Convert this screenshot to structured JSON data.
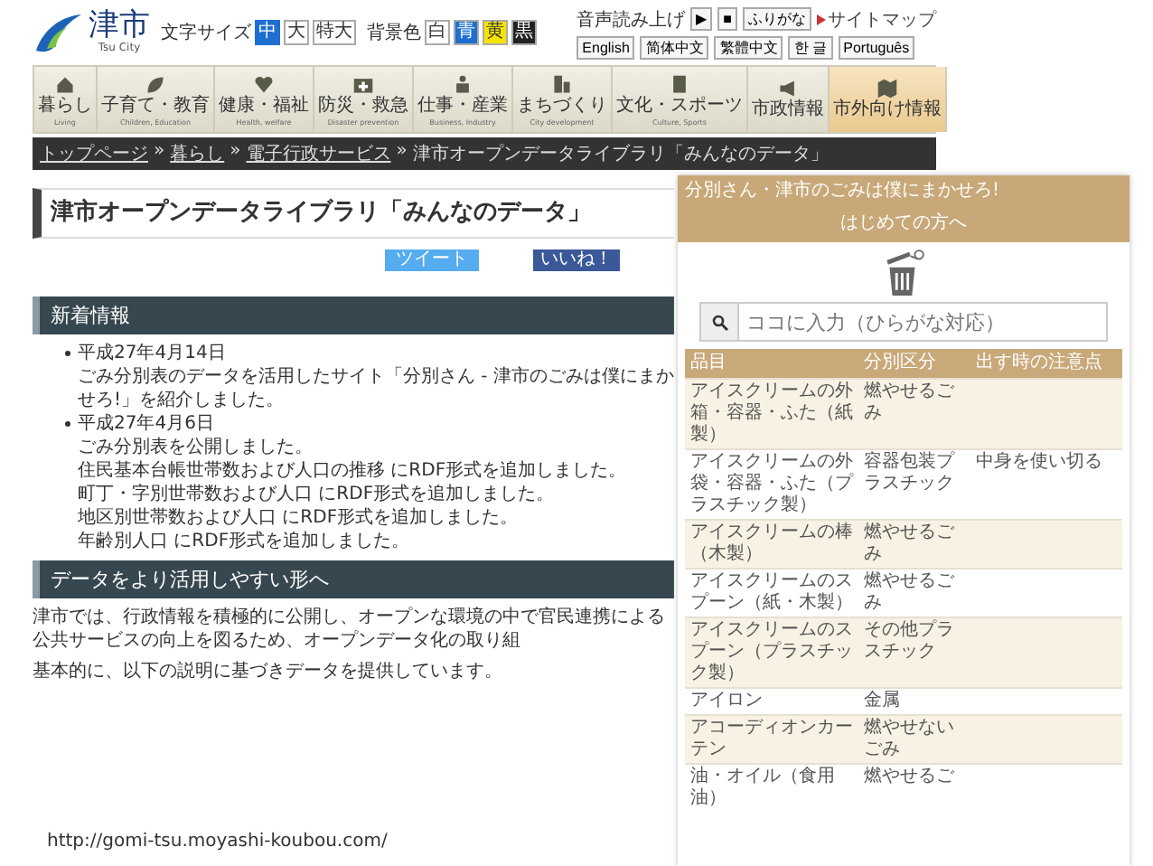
{
  "header": {
    "logo_kanji": "津市",
    "logo_roman": "Tsu City",
    "text_size": {
      "label": "文字サイズ",
      "options": [
        {
          "label": "中",
          "selected": true
        },
        {
          "label": "大",
          "selected": false
        },
        {
          "label": "特大",
          "selected": false
        }
      ]
    },
    "background": {
      "label": "背景色",
      "options": [
        {
          "label": "白",
          "color": "#ffffff"
        },
        {
          "label": "青",
          "color": "#1e6fd0"
        },
        {
          "label": "黄",
          "color": "#f5e400"
        },
        {
          "label": "黒",
          "color": "#222222"
        }
      ]
    },
    "speech": {
      "label": "音声読み上げ",
      "play": "▶",
      "stop": "■"
    },
    "furigana": "ふりがな",
    "sitemap": "サイトマップ",
    "languages": [
      "English",
      "简体中文",
      "繁體中文",
      "한 글",
      "Português"
    ]
  },
  "nav": [
    {
      "label": "暮らし",
      "sub": "Living",
      "selected": false
    },
    {
      "label": "子育て・教育",
      "sub": "Children, Education",
      "selected": false
    },
    {
      "label": "健康・福祉",
      "sub": "Health, welfare",
      "selected": false
    },
    {
      "label": "防災・救急",
      "sub": "Disaster prevention",
      "selected": false
    },
    {
      "label": "仕事・産業",
      "sub": "Business, Industry",
      "selected": false
    },
    {
      "label": "まちづくり",
      "sub": "City development",
      "selected": false
    },
    {
      "label": "文化・スポーツ",
      "sub": "Culture, Sports",
      "selected": false
    },
    {
      "label": "市政情報",
      "selected": false
    },
    {
      "label": "市外向け情報",
      "selected": true
    }
  ],
  "breadcrumb": {
    "separator": "»",
    "items": [
      "トップページ",
      "暮らし",
      "電子行政サービス"
    ],
    "current": "津市オープンデータライブラリ「みんなのデータ」"
  },
  "page_title": "津市オープンデータライブラリ「みんなのデータ」",
  "share": {
    "tweet": "ツイート",
    "like": "いいね！"
  },
  "news": {
    "heading": "新着情報",
    "items": [
      {
        "date": "平成27年4月14日",
        "lines": [
          "ごみ分別表のデータを活用したサイト「分別さん - 津市のごみは僕にまかせろ!」を紹介しました。"
        ]
      },
      {
        "date": "平成27年4月6日",
        "lines": [
          "ごみ分別表を公開しました。",
          "住民基本台帳世帯数および人口の推移 にRDF形式を追加しました。",
          "町丁・字別世帯数および人口 にRDF形式を追加しました。",
          "地区別世帯数および人口 にRDF形式を追加しました。",
          "年齢別人口 にRDF形式を追加しました。"
        ]
      }
    ]
  },
  "data_section": {
    "heading": "データをより活用しやすい形へ",
    "paragraphs": [
      "津市では、行政情報を積極的に公開し、オープンな環境の中で官民連携による公共サービスの向上を図るため、オープンデータ化の取り組",
      "基本的に、以下の説明に基づきデータを提供しています。"
    ]
  },
  "source_url": "http://gomi-tsu.moyashi-koubou.com/",
  "app": {
    "tagline": "分別さん・津市のごみは僕にまかせろ!",
    "intro_link": "はじめての方へ",
    "search": {
      "placeholder": "ココに入力（ひらがな対応）"
    },
    "table": {
      "columns": [
        "品目",
        "分別区分",
        "出す時の注意点"
      ],
      "rows": [
        [
          "アイスクリームの外箱・容器・ふた（紙製）",
          "燃やせるごみ",
          ""
        ],
        [
          "アイスクリームの外袋・容器・ふた（プラスチック製）",
          "容器包装プラスチック",
          "中身を使い切る"
        ],
        [
          "アイスクリームの棒（木製）",
          "燃やせるごみ",
          ""
        ],
        [
          "アイスクリームのスプーン（紙・木製）",
          "燃やせるごみ",
          ""
        ],
        [
          "アイスクリームのスプーン（プラスチック製）",
          "その他プラスチック",
          ""
        ],
        [
          "アイロン",
          "金属",
          ""
        ],
        [
          "アコーディオンカーテン",
          "燃やせないごみ",
          ""
        ],
        [
          "油・オイル（食用油）",
          "燃やせるご",
          ""
        ]
      ]
    }
  }
}
